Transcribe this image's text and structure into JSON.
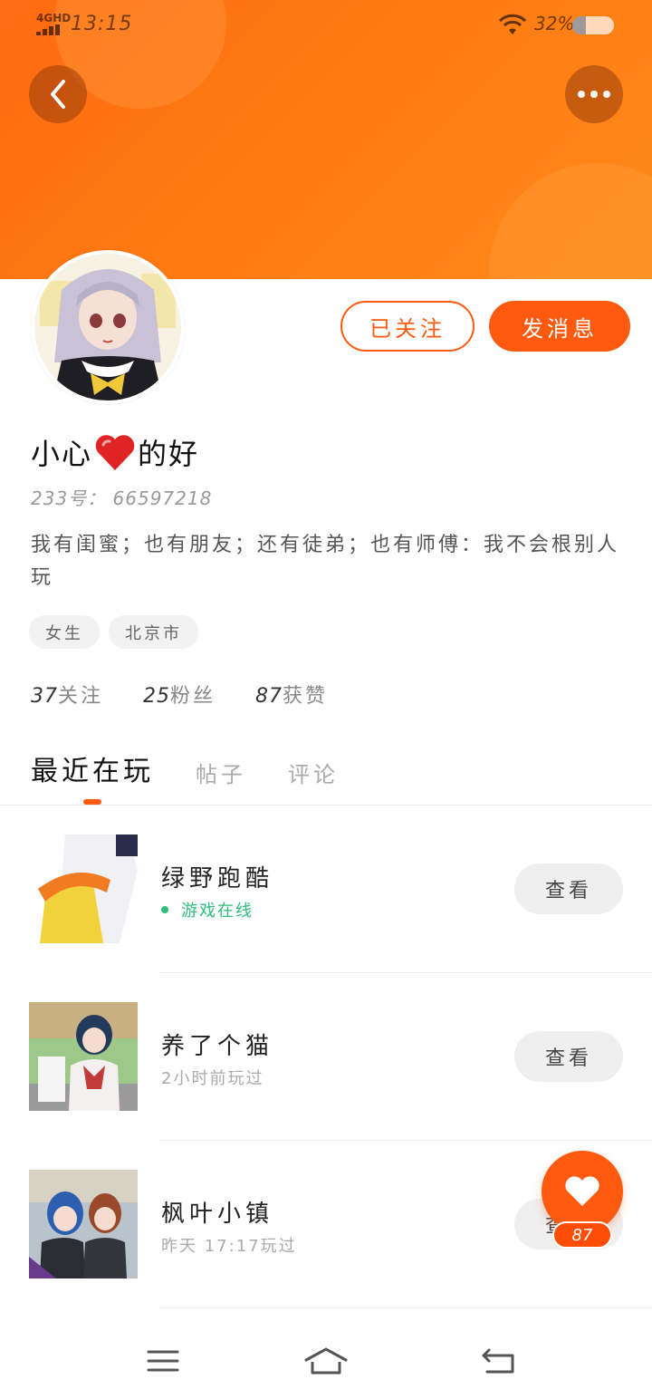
{
  "status_bar": {
    "network": "4GHD",
    "time": "13:15",
    "battery_percent_text": "32%",
    "battery_level": 0.32,
    "icons": [
      "signal-icon",
      "wifi-icon",
      "battery-icon"
    ]
  },
  "header": {
    "accent_color": "#ff6a12",
    "back_icon": "chevron-left-icon",
    "more_icon": "more-dots-icon"
  },
  "profile": {
    "name_before": "小心",
    "name_after": "的好",
    "name_emoji": "heart-icon",
    "uid_text": "233号： 66597218",
    "bio": "我有闺蜜；也有朋友；还有徒弟；也有师傅：我不会根别人玩",
    "tags": [
      "女生",
      "北京市"
    ],
    "stats": [
      {
        "num": "37",
        "label": "关注"
      },
      {
        "num": "25",
        "label": "粉丝"
      },
      {
        "num": "87",
        "label": "获赞"
      }
    ]
  },
  "actions": {
    "follow_label": "已关注",
    "message_label": "发消息"
  },
  "tabs": [
    {
      "label": "最近在玩",
      "active": true
    },
    {
      "label": "帖子",
      "active": false
    },
    {
      "label": "评论",
      "active": false
    }
  ],
  "games": [
    {
      "name": "绿野跑酷",
      "status": "游戏在线",
      "online": true,
      "button": "查看"
    },
    {
      "name": "养了个猫",
      "status": "2小时前玩过",
      "online": false,
      "button": "查看"
    },
    {
      "name": "枫叶小镇",
      "status": "昨天 17:17玩过",
      "online": false,
      "button": "查看"
    }
  ],
  "fab": {
    "icon": "heart-icon",
    "count": "87"
  },
  "nav_bar": {
    "icons": [
      "menu-icon",
      "home-icon",
      "back-nav-icon"
    ]
  },
  "colors": {
    "primary": "#ff5a10",
    "online_green": "#2dbd7c"
  }
}
